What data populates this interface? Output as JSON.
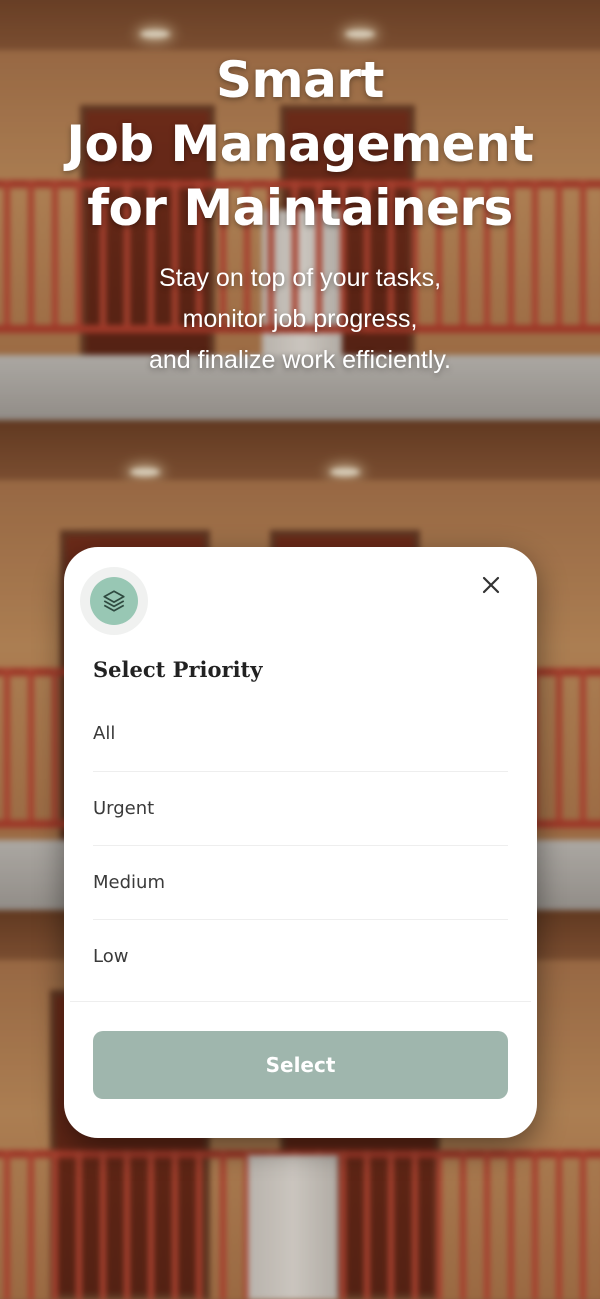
{
  "hero": {
    "title_lines": [
      "Smart",
      "Job Management",
      "for Maintainers"
    ],
    "subtitle_lines": [
      "Stay on top of your tasks,",
      "monitor job progress,",
      "and finalize work efficiently."
    ]
  },
  "modal": {
    "icon": "layers-icon",
    "close_icon": "close-icon",
    "title": "Select Priority",
    "options": [
      {
        "label": "All"
      },
      {
        "label": "Urgent"
      },
      {
        "label": "Medium"
      },
      {
        "label": "Low"
      }
    ],
    "select_label": "Select"
  },
  "colors": {
    "icon_bg": "#98c7b4",
    "button_bg": "#9fb6ad",
    "button_text": "#ffffff",
    "hero_text": "#ffffff"
  }
}
